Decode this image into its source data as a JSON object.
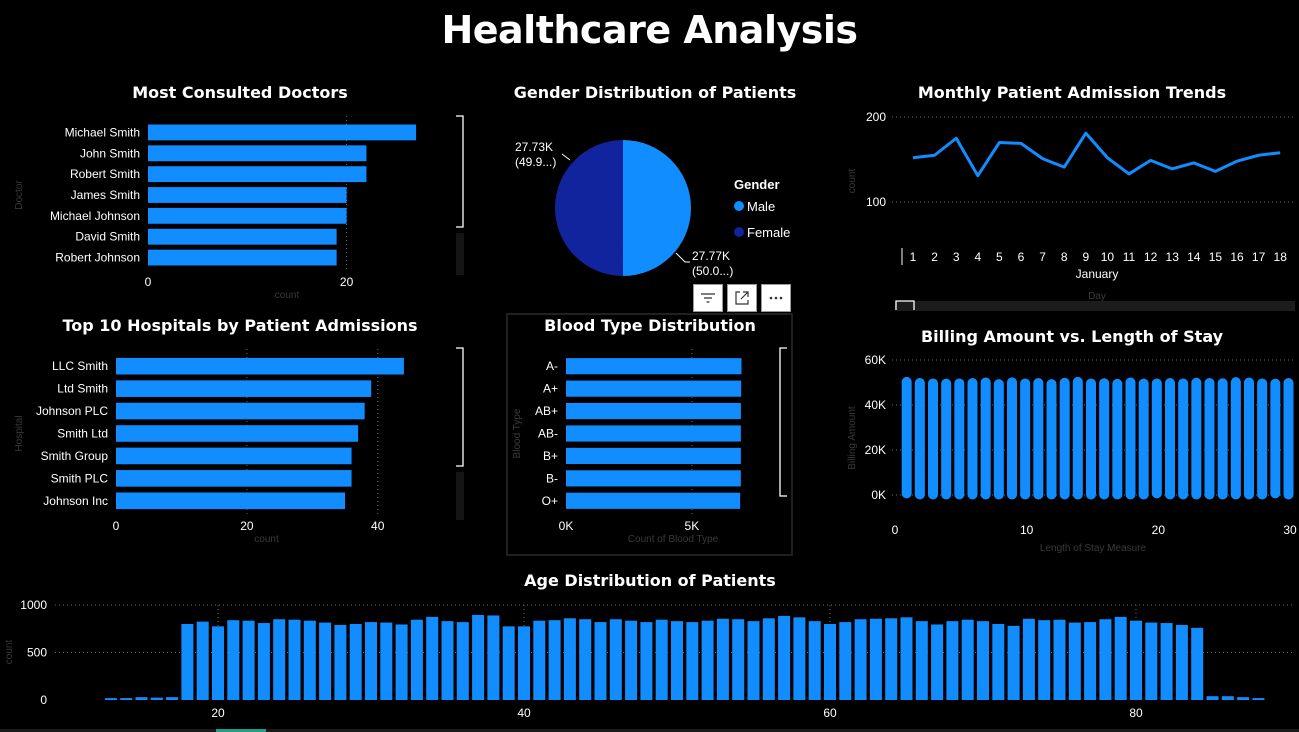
{
  "page": {
    "title": "Healthcare Analysis"
  },
  "colors": {
    "background": "#000000",
    "bar": "#118DFF",
    "female": "#12239E",
    "axis_text": "#ffffff",
    "faint_text": "#3a3a3a"
  },
  "visual_toolbar": {
    "icons": [
      "filter-icon",
      "focus-mode-icon",
      "more-options-icon"
    ]
  },
  "chart_data": [
    {
      "id": "doctors",
      "type": "bar",
      "orientation": "horizontal",
      "title": "Most Consulted Doctors",
      "xlabel": "count",
      "ylabel": "Doctor",
      "categories": [
        "Michael Smith",
        "John Smith",
        "Robert Smith",
        "James Smith",
        "Michael Johnson",
        "David Smith",
        "Robert Johnson"
      ],
      "values": [
        27,
        22,
        22,
        20,
        20,
        19,
        19
      ],
      "xticks": [
        0,
        20
      ],
      "xlim": [
        0,
        28
      ],
      "grid": true
    },
    {
      "id": "gender",
      "type": "pie",
      "title": "Gender Distribution of Patients",
      "legend_title": "Gender",
      "legend_position": "right",
      "slices": [
        {
          "label": "Male",
          "value": 27.77,
          "display": "27.77K",
          "percent": "(50.0...)",
          "color": "#118DFF"
        },
        {
          "label": "Female",
          "value": 27.73,
          "display": "27.73K",
          "percent": "(49.9...)",
          "color": "#12239E"
        }
      ]
    },
    {
      "id": "monthly",
      "type": "line",
      "title": "Monthly Patient Admission Trends",
      "ylabel": "count",
      "xlabel": "Day",
      "x_group_label": "January",
      "x": [
        1,
        2,
        3,
        4,
        5,
        6,
        7,
        8,
        9,
        10,
        11,
        12,
        13,
        14,
        15,
        16,
        17,
        18
      ],
      "y": [
        152,
        155,
        175,
        131,
        170,
        169,
        151,
        141,
        181,
        152,
        133,
        149,
        139,
        146,
        136,
        148,
        155,
        158
      ],
      "yticks": [
        100,
        200
      ],
      "ylim": [
        90,
        200
      ],
      "grid": true
    },
    {
      "id": "hospitals",
      "type": "bar",
      "orientation": "horizontal",
      "title": "Top 10 Hospitals by Patient Admissions",
      "xlabel": "count",
      "ylabel": "Hospital",
      "categories": [
        "LLC Smith",
        "Ltd Smith",
        "Johnson PLC",
        "Smith Ltd",
        "Smith Group",
        "Smith PLC",
        "Johnson Inc"
      ],
      "values": [
        44,
        39,
        38,
        37,
        36,
        36,
        35
      ],
      "xticks": [
        0,
        20,
        40
      ],
      "xlim": [
        0,
        46
      ],
      "grid": true
    },
    {
      "id": "blood",
      "type": "bar",
      "orientation": "horizontal",
      "title": "Blood Type Distribution",
      "xlabel": "Count of Blood Type",
      "ylabel": "Blood Type",
      "categories": [
        "A-",
        "A+",
        "AB+",
        "AB-",
        "B+",
        "B-",
        "O+"
      ],
      "values": [
        6970,
        6956,
        6947,
        6945,
        6945,
        6944,
        6917
      ],
      "xticks": [
        0,
        5000
      ],
      "xtick_labels": [
        "0K",
        "5K"
      ],
      "xlim": [
        0,
        8500
      ],
      "grid": true
    },
    {
      "id": "billing",
      "type": "bar",
      "subtype": "range",
      "title": "Billing Amount vs. Length of Stay",
      "xlabel": "Length of Stay Measure",
      "ylabel": "Billing Amount",
      "x": [
        1,
        2,
        3,
        4,
        5,
        6,
        7,
        8,
        9,
        10,
        11,
        12,
        13,
        14,
        15,
        16,
        17,
        18,
        19,
        20,
        21,
        22,
        23,
        24,
        25,
        26,
        27,
        28,
        29,
        30
      ],
      "low": [
        -1500,
        -2000,
        -2000,
        -2000,
        -2000,
        -2000,
        -2000,
        -2000,
        -2000,
        -2000,
        -2000,
        -2000,
        -2000,
        -2000,
        -2000,
        -2000,
        -2000,
        -2000,
        -2000,
        -1500,
        -2000,
        -2000,
        -2000,
        -2000,
        -2000,
        -2000,
        -2000,
        -2000,
        -1500,
        -2000
      ],
      "high": [
        52500,
        52000,
        51800,
        51700,
        51800,
        52000,
        52200,
        51500,
        52300,
        51800,
        52000,
        51500,
        52100,
        52500,
        51800,
        51900,
        51600,
        52200,
        51700,
        51800,
        52000,
        51800,
        52100,
        52000,
        51900,
        52400,
        52200,
        51800,
        51700,
        52000
      ],
      "yticks": [
        0,
        20000,
        40000,
        60000
      ],
      "ytick_labels": [
        "0K",
        "20K",
        "40K",
        "60K"
      ],
      "xticks": [
        0,
        10,
        20,
        30
      ],
      "ylim": [
        -5000,
        60000
      ],
      "xlim": [
        0,
        30
      ],
      "grid": true
    },
    {
      "id": "age",
      "type": "bar",
      "title": "Age Distribution of Patients",
      "ylabel": "count",
      "x": [
        13,
        14,
        15,
        16,
        17,
        18,
        19,
        20,
        21,
        22,
        23,
        24,
        25,
        26,
        27,
        28,
        29,
        30,
        31,
        32,
        33,
        34,
        35,
        36,
        37,
        38,
        39,
        40,
        41,
        42,
        43,
        44,
        45,
        46,
        47,
        48,
        49,
        50,
        51,
        52,
        53,
        54,
        55,
        56,
        57,
        58,
        59,
        60,
        61,
        62,
        63,
        64,
        65,
        66,
        67,
        68,
        69,
        70,
        71,
        72,
        73,
        74,
        75,
        76,
        77,
        78,
        79,
        80,
        81,
        82,
        83,
        84,
        85,
        86,
        87,
        88,
        89
      ],
      "values": [
        20,
        20,
        30,
        25,
        30,
        800,
        825,
        775,
        840,
        835,
        810,
        850,
        845,
        835,
        815,
        790,
        800,
        820,
        815,
        795,
        845,
        875,
        830,
        820,
        895,
        890,
        775,
        775,
        835,
        840,
        860,
        850,
        820,
        850,
        835,
        820,
        845,
        830,
        820,
        835,
        855,
        850,
        830,
        860,
        885,
        870,
        830,
        800,
        820,
        850,
        855,
        860,
        870,
        830,
        795,
        830,
        845,
        830,
        800,
        780,
        855,
        840,
        845,
        815,
        820,
        850,
        875,
        835,
        815,
        810,
        790,
        760,
        40,
        40,
        30,
        20
      ],
      "xticks": [
        20,
        40,
        60,
        80
      ],
      "yticks": [
        0,
        500,
        1000
      ],
      "xlim": [
        11.5,
        92
      ],
      "ylim": [
        0,
        1000
      ],
      "grid": true
    }
  ]
}
